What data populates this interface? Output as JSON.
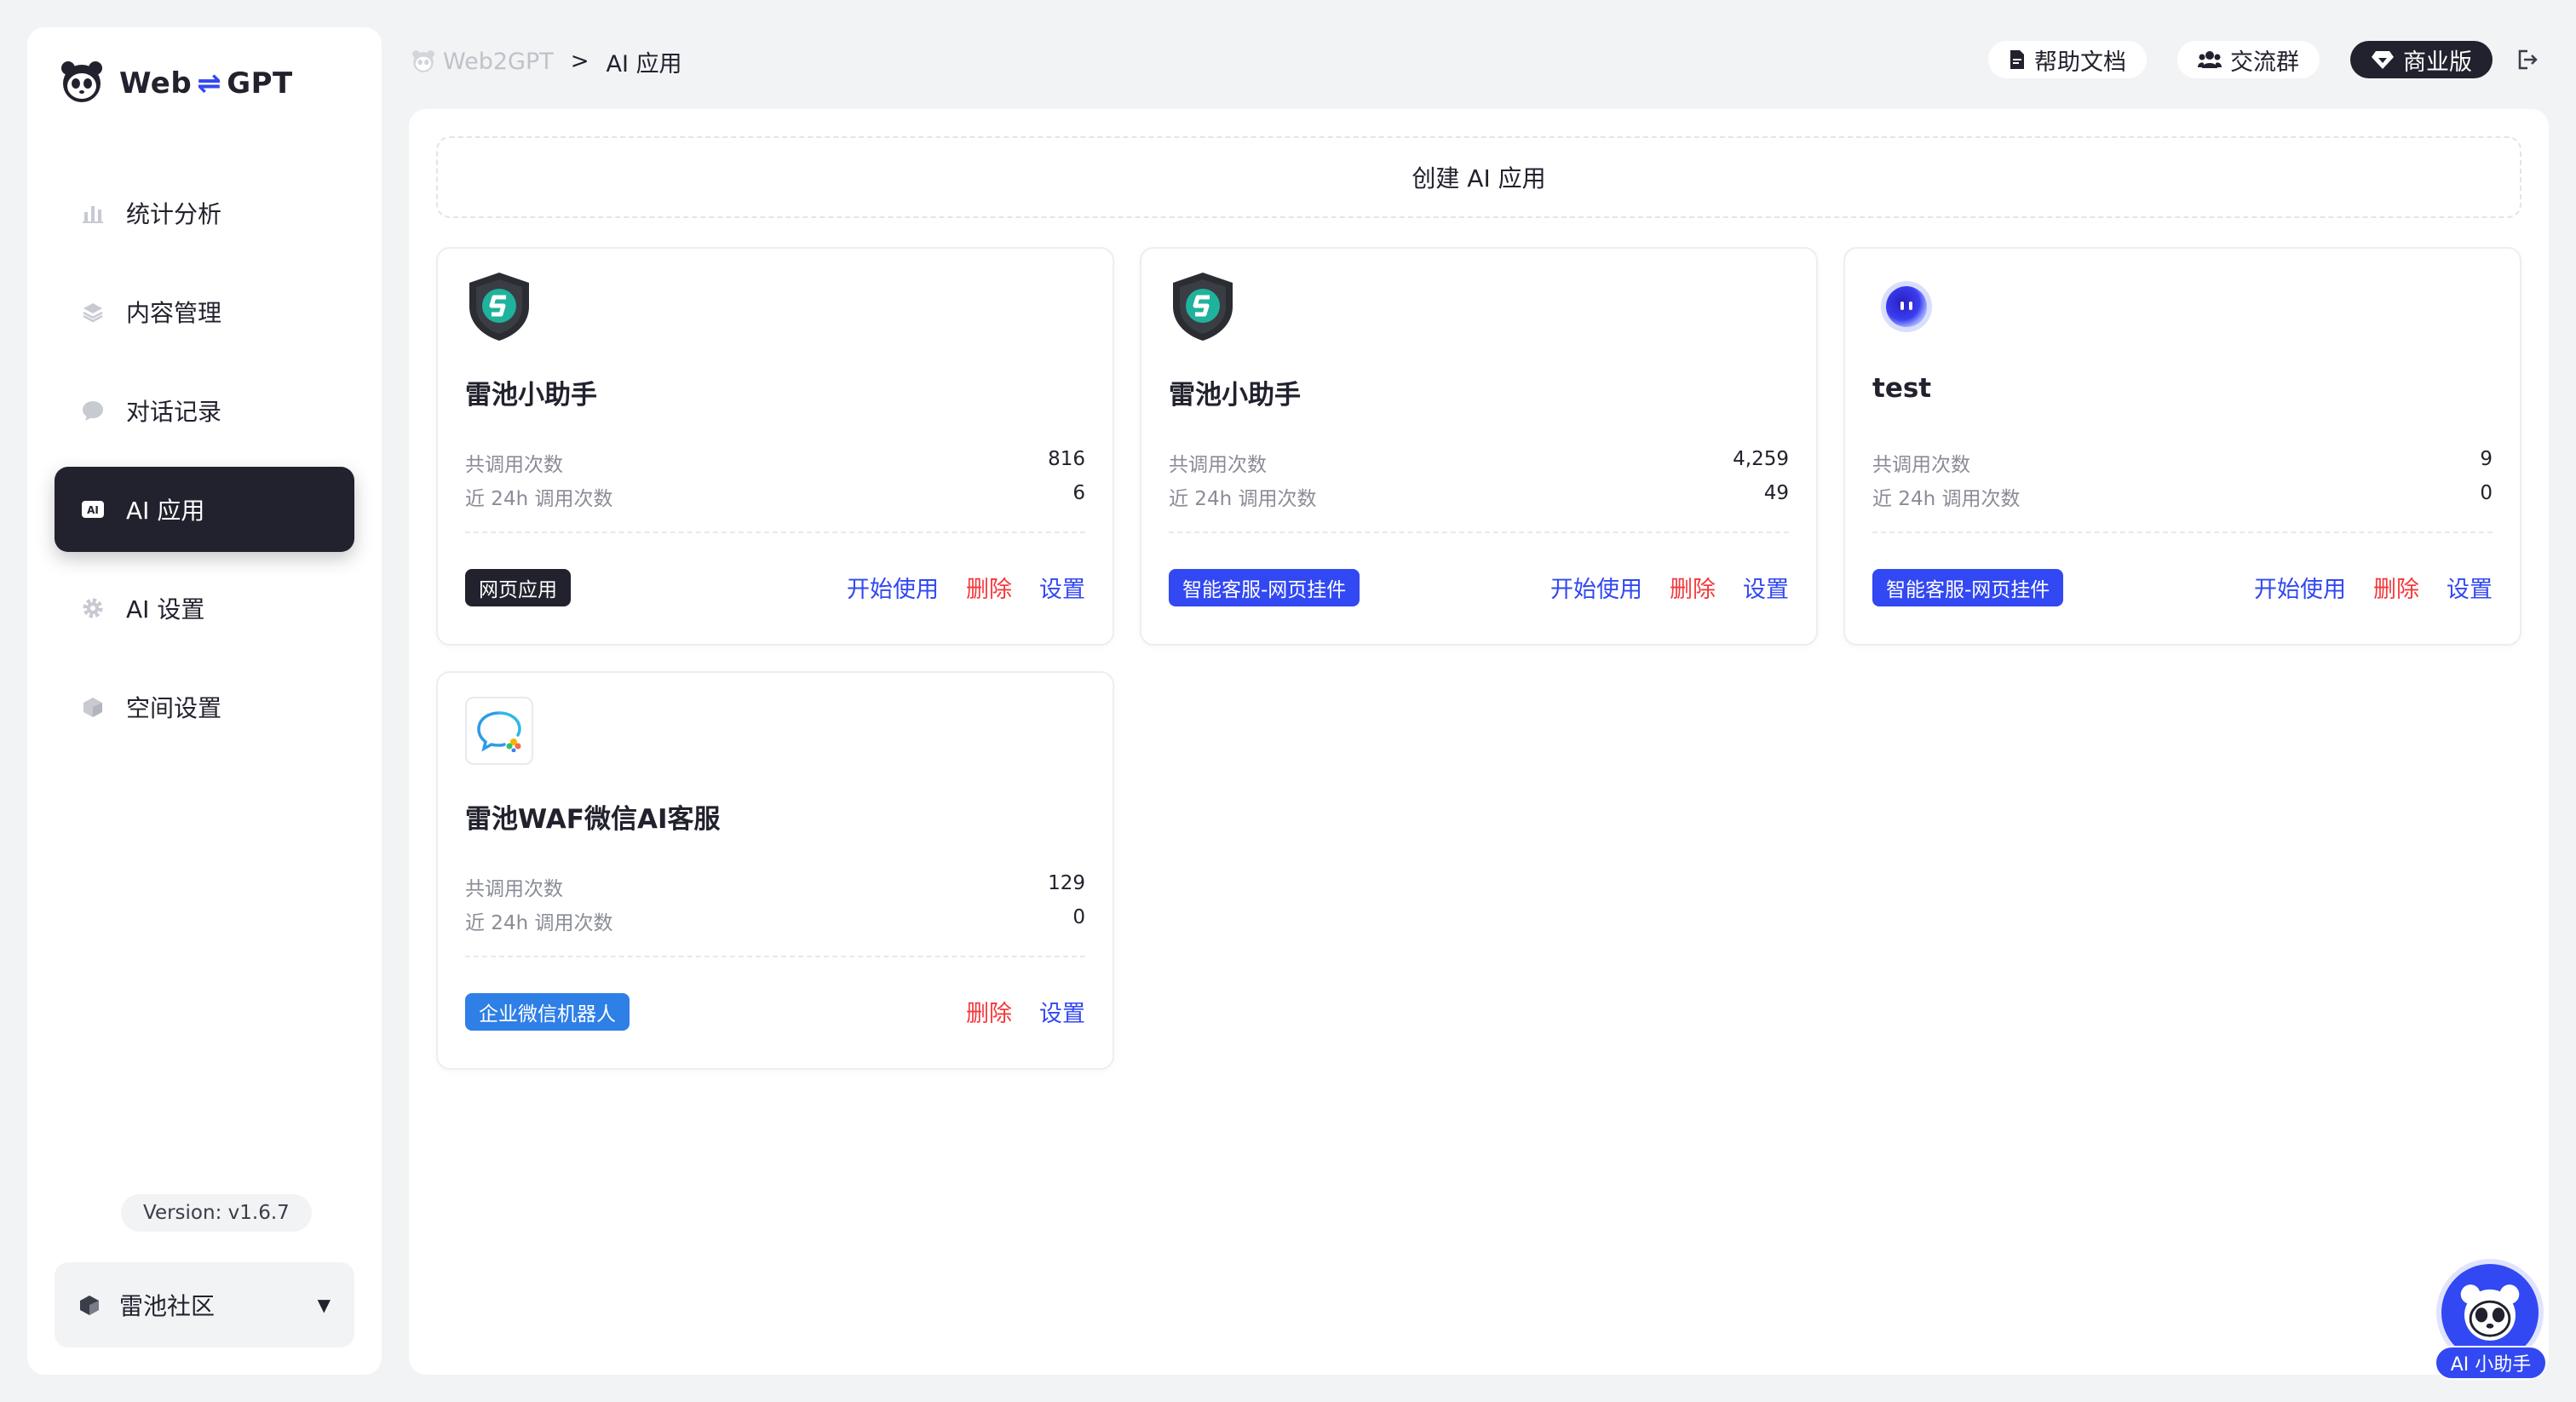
{
  "app": {
    "name_left": "Web",
    "name_swap": "⇌",
    "name_right": "GPT",
    "logo_icon": "panda-icon"
  },
  "sidebar": {
    "items": [
      {
        "label": "统计分析",
        "icon": "bar-chart-icon",
        "active": false
      },
      {
        "label": "内容管理",
        "icon": "layers-icon",
        "active": false
      },
      {
        "label": "对话记录",
        "icon": "chat-bubble-icon",
        "active": false
      },
      {
        "label": "AI 应用",
        "icon": "ai-badge-icon",
        "active": true
      },
      {
        "label": "AI 设置",
        "icon": "gear-icon",
        "active": false
      },
      {
        "label": "空间设置",
        "icon": "cube-icon",
        "active": false
      }
    ],
    "version": "Version: v1.6.7",
    "space": {
      "label": "雷池社区",
      "icon": "cube-icon"
    }
  },
  "breadcrumb": {
    "home": "Web2GPT",
    "separator": ">",
    "current": "AI 应用"
  },
  "header": {
    "help_docs": "帮助文档",
    "community": "交流群",
    "commercial": "商业版"
  },
  "main": {
    "create_label": "创建 AI 应用",
    "stat_total_label": "共调用次数",
    "stat_24h_label": "近 24h 调用次数",
    "action_start": "开始使用",
    "action_delete": "删除",
    "action_settings": "设置",
    "cards": [
      {
        "name": "雷池小助手",
        "total": "816",
        "recent": "6",
        "tag": "网页应用",
        "tag_color": "#21222d",
        "avatar": "shield-icon",
        "has_start": true
      },
      {
        "name": "雷池小助手",
        "total": "4,259",
        "recent": "49",
        "tag": "智能客服-网页挂件",
        "tag_color": "#3248f2",
        "avatar": "shield-icon",
        "has_start": true
      },
      {
        "name": "test",
        "total": "9",
        "recent": "0",
        "tag": "智能客服-网页挂件",
        "tag_color": "#3248f2",
        "avatar": "bot-orb-icon",
        "has_start": true
      },
      {
        "name": "雷池WAF微信AI客服",
        "total": "129",
        "recent": "0",
        "tag": "企业微信机器人",
        "tag_color": "#2e7fe6",
        "avatar": "wecom-chat-icon",
        "has_start": false
      }
    ]
  },
  "assistant": {
    "label": "AI 小助手",
    "icon": "panda-icon"
  },
  "colors": {
    "accent": "#3248f2",
    "danger": "#f5383b",
    "dark": "#21222d",
    "background": "#f2f3f5"
  }
}
